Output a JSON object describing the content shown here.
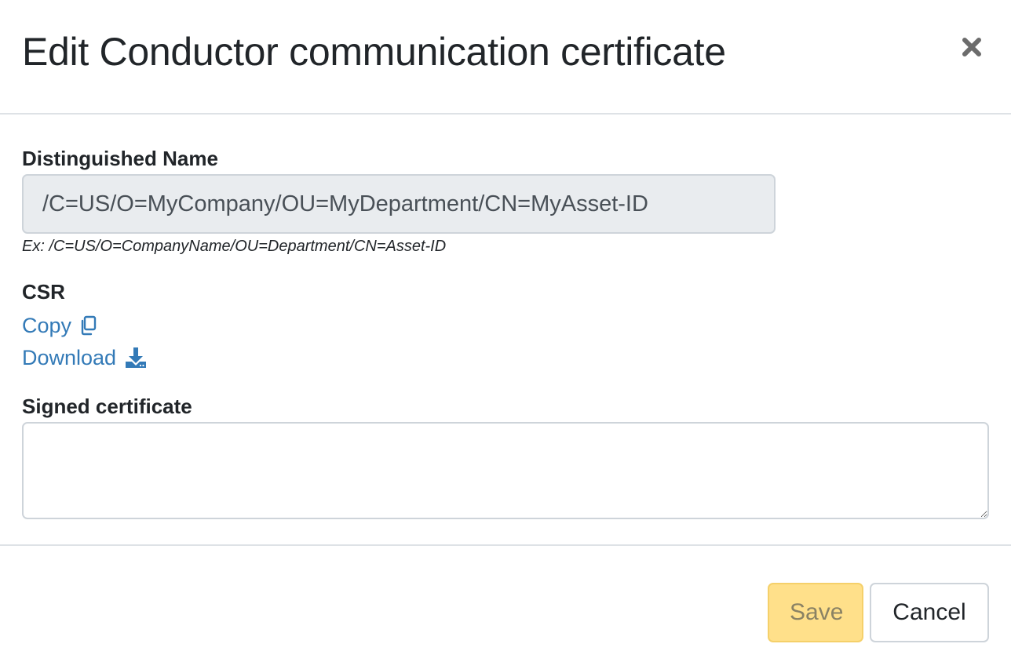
{
  "modal": {
    "title": "Edit Conductor communication certificate",
    "close_icon": "close-icon"
  },
  "fields": {
    "distinguished_name": {
      "label": "Distinguished Name",
      "value": "/C=US/O=MyCompany/OU=MyDepartment/CN=MyAsset-ID",
      "help": "Ex: /C=US/O=CompanyName/OU=Department/CN=Asset-ID",
      "disabled": true
    },
    "csr": {
      "label": "CSR",
      "copy_label": "Copy",
      "copy_icon": "copy-icon",
      "download_label": "Download",
      "download_icon": "download-icon"
    },
    "signed_certificate": {
      "label": "Signed certificate",
      "value": ""
    }
  },
  "footer": {
    "save_label": "Save",
    "cancel_label": "Cancel"
  },
  "colors": {
    "link": "#337ab7",
    "save_bg": "#ffe08a",
    "disabled_input_bg": "#e9ecef",
    "border": "#ced4da"
  }
}
